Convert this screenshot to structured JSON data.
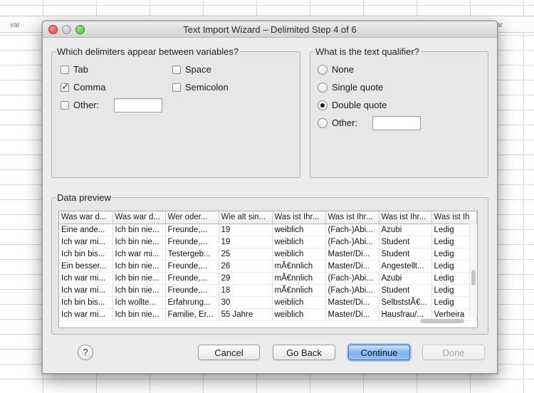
{
  "background_sheet": {
    "left_column_header": "var",
    "right_column_header": "ar"
  },
  "dialog": {
    "title": "Text Import Wizard – Delimited Step 4 of 6",
    "delimiters": {
      "legend": "Which delimiters appear between variables?",
      "tab": {
        "label": "Tab",
        "checked": false
      },
      "space": {
        "label": "Space",
        "checked": false
      },
      "comma": {
        "label": "Comma",
        "checked": true
      },
      "semicolon": {
        "label": "Semicolon",
        "checked": false
      },
      "other": {
        "label": "Other:",
        "checked": false,
        "value": ""
      }
    },
    "qualifier": {
      "legend": "What is the text qualifier?",
      "none": {
        "label": "None",
        "selected": false
      },
      "single": {
        "label": "Single quote",
        "selected": false
      },
      "double": {
        "label": "Double quote",
        "selected": true
      },
      "other": {
        "label": "Other:",
        "selected": false,
        "value": ""
      }
    },
    "preview": {
      "legend": "Data preview",
      "headers": [
        "Was war d...",
        "Was war d...",
        "Wer oder...",
        "Wie alt sin...",
        "Was ist Ihr...",
        "Was ist Ihr...",
        "Was ist Ihr...",
        "Was ist Ih"
      ],
      "rows": [
        [
          "Eine ande...",
          "Ich bin nie...",
          "Freunde,...",
          "19",
          "weiblich",
          "(Fach-)Abi...",
          "Azubi",
          "Ledig"
        ],
        [
          "Ich war mi...",
          "Ich bin nie...",
          "Freunde,...",
          "19",
          "weiblich",
          "(Fach-)Abi...",
          "Student",
          "Ledig"
        ],
        [
          "Ich bin bis...",
          "Ich war mi...",
          "Testergeb...",
          "25",
          "weiblich",
          "Master/Di...",
          "Student",
          "Ledig"
        ],
        [
          "Ein besser...",
          "Ich bin nie...",
          "Freunde,...",
          "26",
          "mÃ€nnlich",
          "Master/Di...",
          "Angestellt...",
          "Ledig"
        ],
        [
          "Ich war mi...",
          "Ich bin nie...",
          "Freunde,...",
          "29",
          "mÃ€nnlich",
          "(Fach-)Abi...",
          "Azubi",
          "Ledig"
        ],
        [
          "Ich war mi...",
          "Ich bin nie...",
          "Freunde,...",
          "18",
          "mÃ€nnlich",
          "(Fach-)Abi...",
          "Student",
          "Ledig"
        ],
        [
          "Ich bin bis...",
          "Ich wollte...",
          "Erfahrung...",
          "30",
          "weiblich",
          "Master/Di...",
          "SelbststÃ€...",
          "Ledig"
        ],
        [
          "Ich war mi...",
          "Ich bin nie...",
          "Familie, Er...",
          "55 Jahre",
          "weiblich",
          "Master/Di...",
          "Hausfrau/...",
          "Verheira"
        ]
      ]
    },
    "buttons": {
      "help": "?",
      "cancel": "Cancel",
      "back": "Go Back",
      "continue": "Continue",
      "done": "Done"
    }
  }
}
